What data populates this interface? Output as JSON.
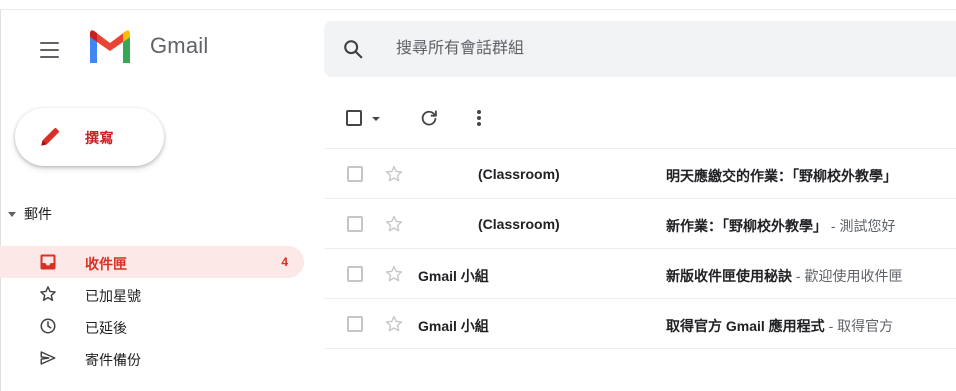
{
  "header": {
    "brand": "Gmail",
    "search_placeholder": "搜尋所有會話群組"
  },
  "compose": {
    "label": "撰寫"
  },
  "sidebar": {
    "section_label": "郵件",
    "items": [
      {
        "label": "收件匣",
        "icon": "inbox-icon",
        "count": "4",
        "active": true
      },
      {
        "label": "已加星號",
        "icon": "star-icon",
        "count": "",
        "active": false
      },
      {
        "label": "已延後",
        "icon": "clock-icon",
        "count": "",
        "active": false
      },
      {
        "label": "寄件備份",
        "icon": "send-icon",
        "count": "",
        "active": false
      }
    ]
  },
  "emails": [
    {
      "sender": "(Classroom)",
      "subject": "明天應繳交的作業：「野柳校外教學」",
      "preview": ""
    },
    {
      "sender": "(Classroom)",
      "subject": "新作業：「野柳校外教學」",
      "preview": " - 測試您好"
    },
    {
      "sender": "Gmail 小組",
      "subject": "新版收件匣使用秘訣",
      "preview": " - 歡迎使用收件匣"
    },
    {
      "sender": "Gmail 小組",
      "subject": "取得官方 Gmail 應用程式",
      "preview": " - 取得官方"
    }
  ],
  "colors": {
    "accent_red": "#d93025",
    "compose_red": "#c5221f",
    "active_bg": "#fce8e6",
    "search_bg": "#f1f3f4",
    "icon_gray": "#5f6368"
  }
}
